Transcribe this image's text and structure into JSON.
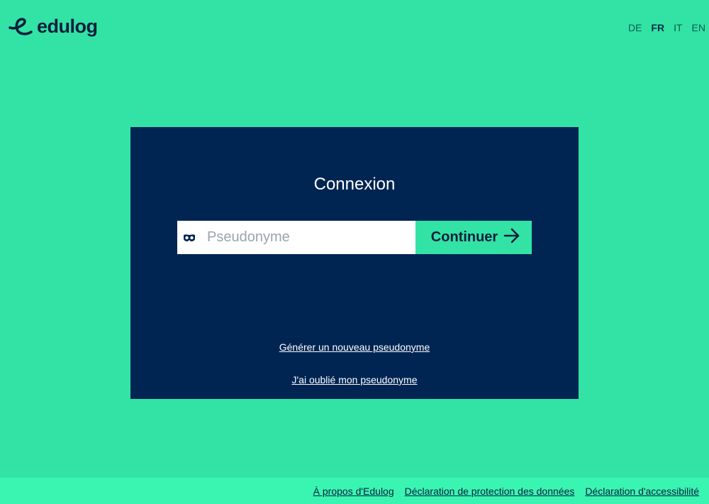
{
  "header": {
    "logo_text": "edulog",
    "languages": [
      {
        "code": "DE",
        "active": false
      },
      {
        "code": "FR",
        "active": true
      },
      {
        "code": "IT",
        "active": false
      },
      {
        "code": "EN",
        "active": false
      }
    ]
  },
  "login": {
    "title": "Connexion",
    "pseudonym_placeholder": "Pseudonyme",
    "pseudonym_value": "",
    "continue_label": "Continuer",
    "generate_link": "Générer un nouveau pseudonyme",
    "forgot_link": "J'ai oublié mon pseudonyme"
  },
  "footer": {
    "links": [
      "À propos d'Edulog",
      "Déclaration de protection des données",
      "Déclaration d'accessibilité"
    ]
  },
  "icons": {
    "mask": "mask-icon",
    "arrow": "arrow-right-icon",
    "logo": "edulog-logo-icon"
  },
  "colors": {
    "background": "#33e3a5",
    "card": "#002553",
    "accent": "#33e3a5",
    "footer": "#3af5b2",
    "text_dark": "#0b1e3d"
  }
}
